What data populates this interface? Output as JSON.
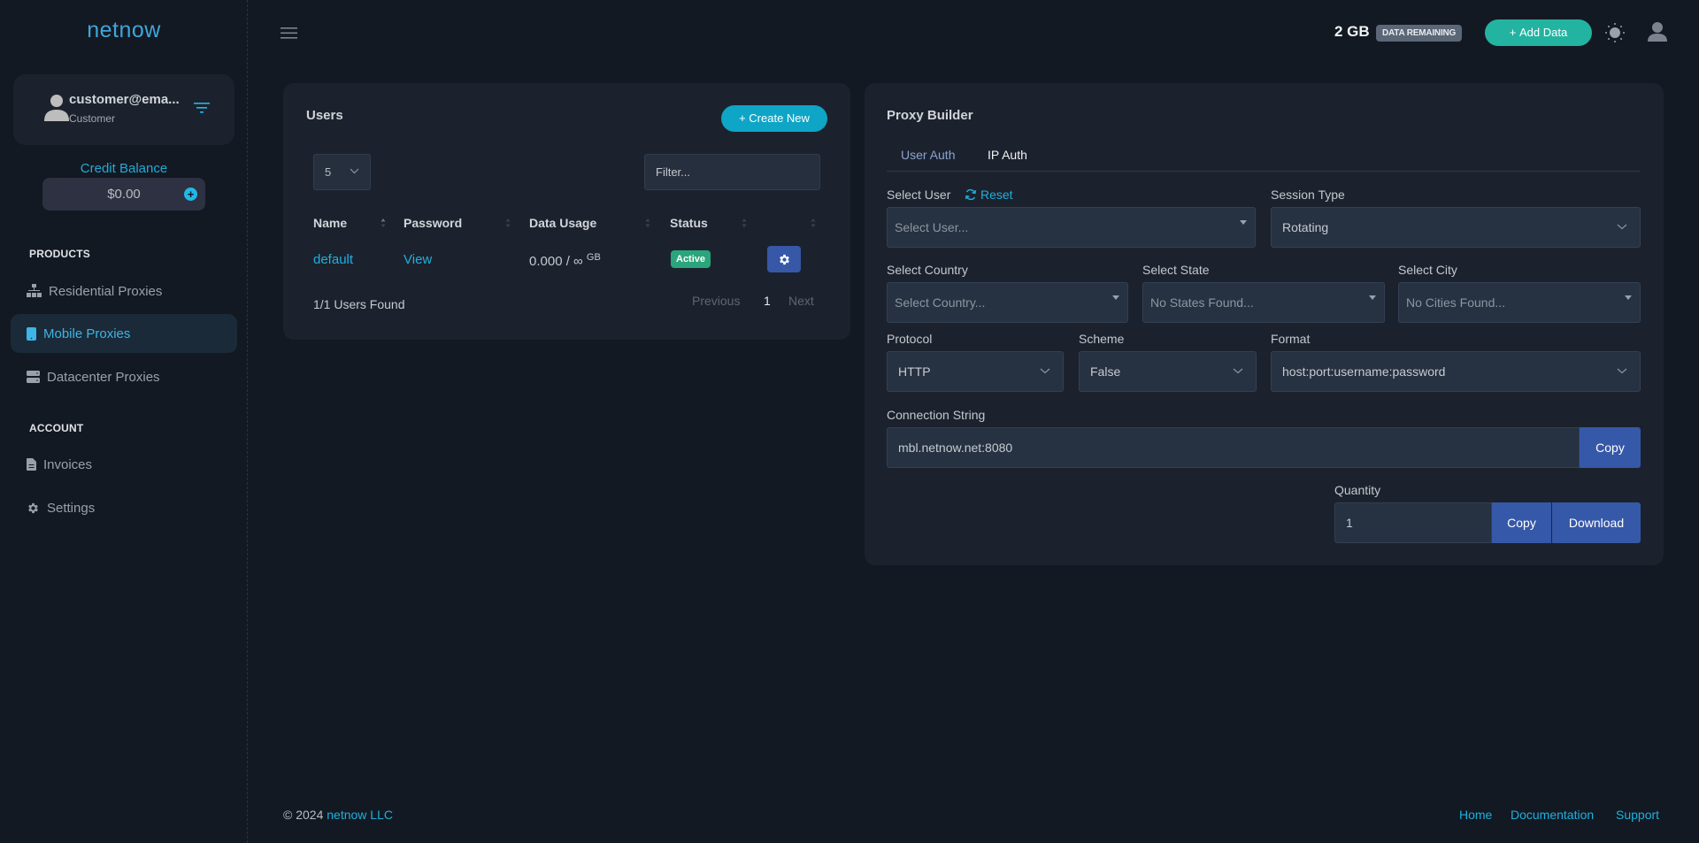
{
  "brand": "netnow",
  "profile": {
    "name": "customer@ema...",
    "role": "Customer"
  },
  "credit": {
    "label": "Credit Balance",
    "value": "$0.00"
  },
  "sidebar": {
    "products_label": "PRODUCTS",
    "account_label": "ACCOUNT",
    "items": [
      {
        "label": "Residential Proxies",
        "icon": "network-icon"
      },
      {
        "label": "Mobile Proxies",
        "icon": "mobile-icon",
        "active": true
      },
      {
        "label": "Datacenter Proxies",
        "icon": "server-icon"
      },
      {
        "label": "Invoices",
        "icon": "document-icon"
      },
      {
        "label": "Settings",
        "icon": "gear-icon"
      }
    ]
  },
  "header": {
    "data_amount": "2 GB",
    "data_badge": "DATA REMAINING",
    "add_data": "Add Data"
  },
  "users": {
    "title": "Users",
    "create_new": "Create New",
    "page_size": "5",
    "filter_placeholder": "Filter...",
    "columns": [
      "Name",
      "Password",
      "Data Usage",
      "Status"
    ],
    "rows": [
      {
        "name": "default",
        "password": "View",
        "usage": "0.000 / ∞",
        "unit": "GB",
        "status": "Active"
      }
    ],
    "found": "1/1 Users Found",
    "pager": {
      "previous": "Previous",
      "current": "1",
      "next": "Next"
    }
  },
  "proxy": {
    "title": "Proxy Builder",
    "tabs": [
      "User Auth",
      "IP Auth"
    ],
    "active_tab": "IP Auth",
    "select_user_label": "Select User",
    "reset": "Reset",
    "select_user_placeholder": "Select User...",
    "session_type_label": "Session Type",
    "session_type": "Rotating",
    "country_label": "Select Country",
    "country_placeholder": "Select Country...",
    "state_label": "Select State",
    "state_placeholder": "No States Found...",
    "city_label": "Select City",
    "city_placeholder": "No Cities Found...",
    "protocol_label": "Protocol",
    "protocol": "HTTP",
    "scheme_label": "Scheme",
    "scheme": "False",
    "format_label": "Format",
    "format": "host:port:username:password",
    "connection_label": "Connection String",
    "connection": "mbl.netnow.net:8080",
    "copy": "Copy",
    "quantity_label": "Quantity",
    "quantity": "1",
    "download": "Download"
  },
  "footer": {
    "copyright": "© 2024",
    "company": "netnow LLC",
    "links": [
      "Home",
      "Documentation",
      "Support"
    ]
  },
  "colors": {
    "accent": "#1eb0df",
    "teal": "#23b3a1",
    "blue": "#3658a8",
    "active": "#2ba57b"
  }
}
